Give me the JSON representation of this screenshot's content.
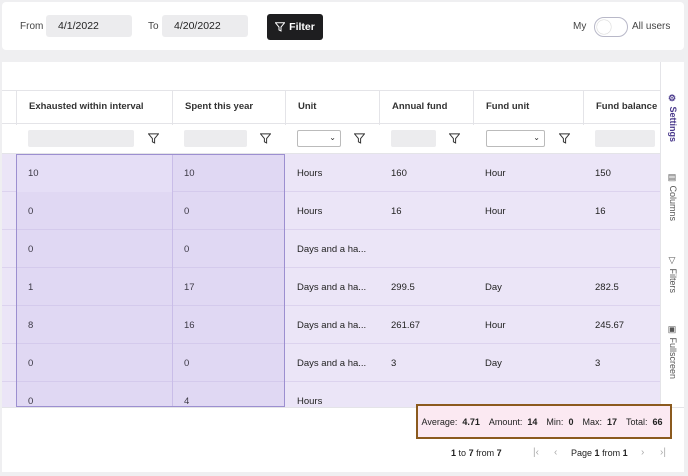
{
  "toolbar": {
    "from_label": "From",
    "from_value": "4/1/2022",
    "to_label": "To",
    "to_value": "4/20/2022",
    "filter_label": "Filter",
    "my_label": "My",
    "all_users_label": "All users"
  },
  "columns": [
    {
      "label": "Exhausted within interval",
      "filter": "input"
    },
    {
      "label": "Spent this year",
      "filter": "input"
    },
    {
      "label": "Unit",
      "filter": "select"
    },
    {
      "label": "Annual fund",
      "filter": "input"
    },
    {
      "label": "Fund unit",
      "filter": "select"
    },
    {
      "label": "Fund balance",
      "filter": "input"
    }
  ],
  "rows": [
    [
      "10",
      "10",
      "Hours",
      "160",
      "Hour",
      "150"
    ],
    [
      "0",
      "0",
      "Hours",
      "16",
      "Hour",
      "16"
    ],
    [
      "0",
      "0",
      "Days and a ha...",
      "",
      "",
      ""
    ],
    [
      "1",
      "17",
      "Days and a ha...",
      "299.5",
      "Day",
      "282.5"
    ],
    [
      "8",
      "16",
      "Days and a ha...",
      "261.67",
      "Hour",
      "245.67"
    ],
    [
      "0",
      "0",
      "Days and a ha...",
      "3",
      "Day",
      "3"
    ],
    [
      "0",
      "4",
      "Hours",
      "",
      "",
      ""
    ]
  ],
  "sidebar": {
    "items": [
      {
        "label": "Settings",
        "icon": "gear-icon",
        "active": true
      },
      {
        "label": "Columns",
        "icon": "columns-icon",
        "active": false
      },
      {
        "label": "Filters",
        "icon": "filter-icon",
        "active": false
      },
      {
        "label": "Fullscreen",
        "icon": "fullscreen-icon",
        "active": false
      }
    ]
  },
  "aggregates": {
    "average_label": "Average:",
    "average": "4.71",
    "amount_label": "Amount:",
    "amount": "14",
    "min_label": "Min:",
    "min": "0",
    "max_label": "Max:",
    "max": "17",
    "total_label": "Total:",
    "total": "66"
  },
  "pagination": {
    "range_from": "1",
    "range_to_word": "to",
    "range_to": "7",
    "from_word": "from",
    "count": "7",
    "page_word": "Page",
    "page": "1",
    "of_word": "from",
    "page_count": "1"
  },
  "colors": {
    "accent": "#4a3a8c",
    "selection": "#ebe5f7",
    "highlight_border": "#8b5a1e"
  }
}
